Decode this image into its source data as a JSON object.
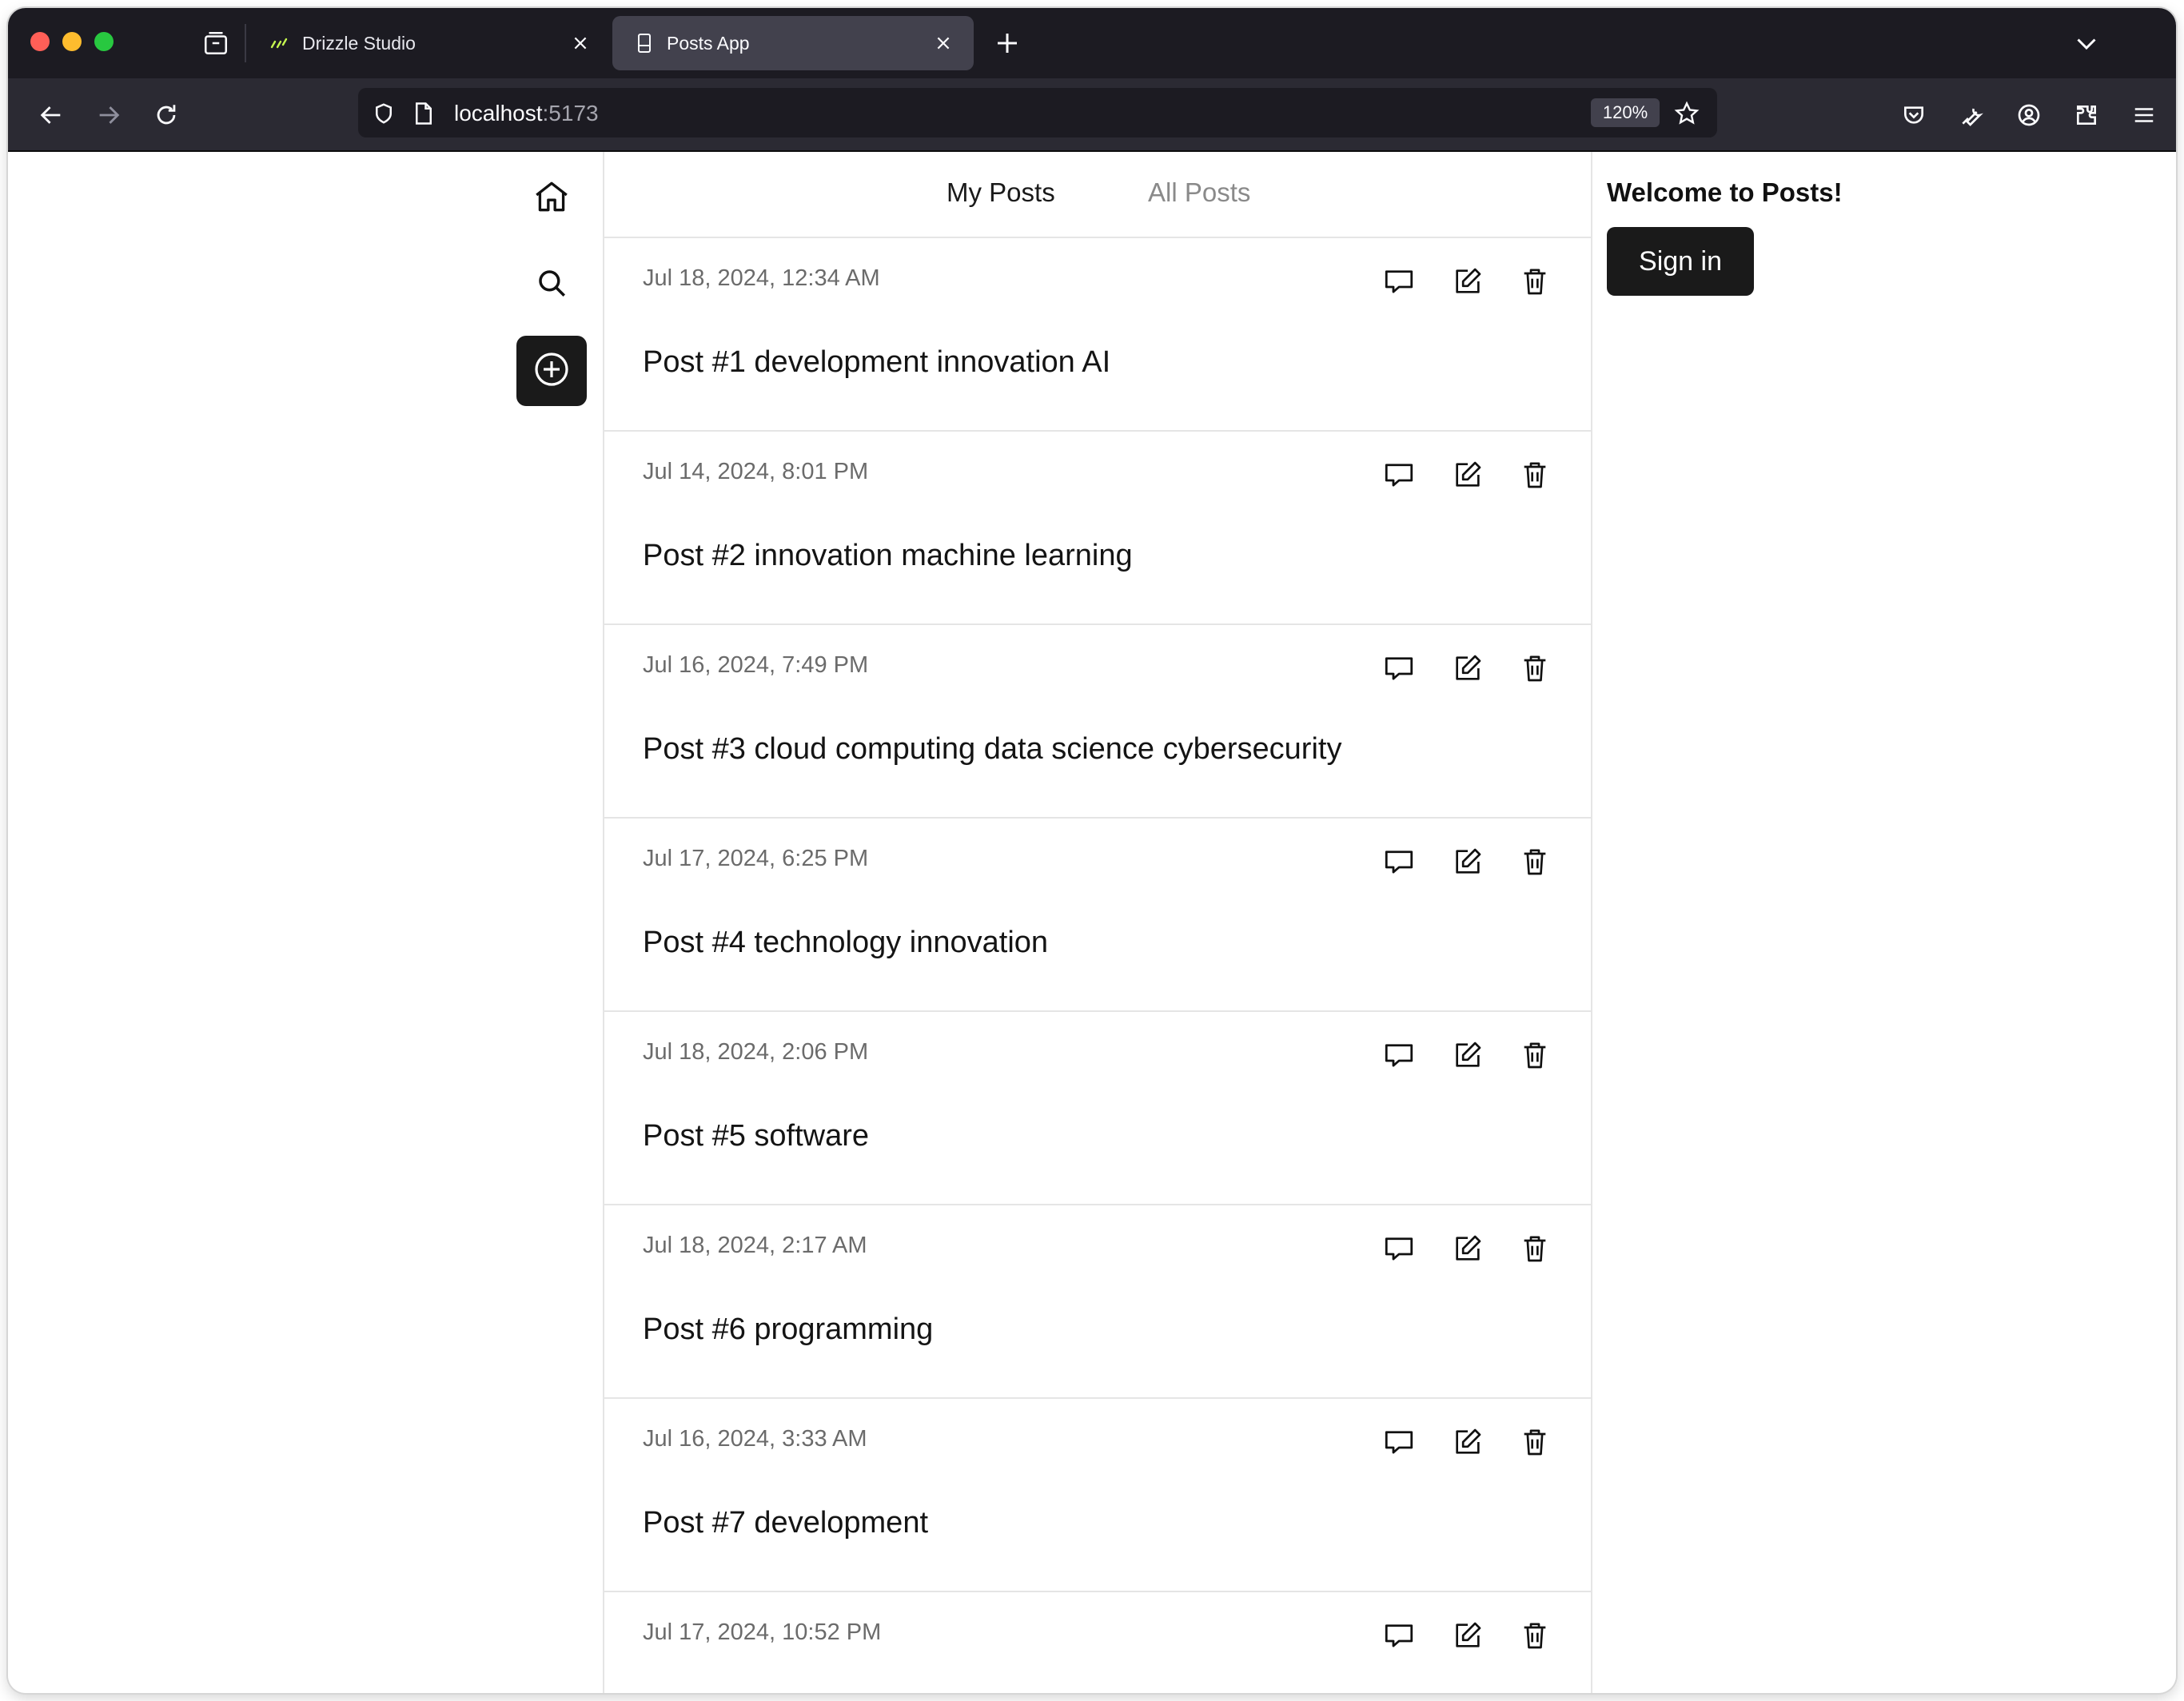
{
  "browser": {
    "tabs": [
      {
        "title": "Drizzle Studio",
        "active": false
      },
      {
        "title": "Posts App",
        "active": true
      }
    ],
    "url_host": "localhost",
    "url_port": ":5173",
    "zoom": "120%"
  },
  "feed": {
    "tabs": [
      {
        "label": "My Posts",
        "selected": true
      },
      {
        "label": "All Posts",
        "selected": false
      }
    ],
    "posts": [
      {
        "date": "Jul 18, 2024, 12:34 AM",
        "title": "Post #1 development innovation AI"
      },
      {
        "date": "Jul 14, 2024, 8:01 PM",
        "title": "Post #2 innovation machine learning"
      },
      {
        "date": "Jul 16, 2024, 7:49 PM",
        "title": "Post #3 cloud computing data science cybersecurity"
      },
      {
        "date": "Jul 17, 2024, 6:25 PM",
        "title": "Post #4 technology innovation"
      },
      {
        "date": "Jul 18, 2024, 2:06 PM",
        "title": "Post #5 software"
      },
      {
        "date": "Jul 18, 2024, 2:17 AM",
        "title": "Post #6 programming"
      },
      {
        "date": "Jul 16, 2024, 3:33 AM",
        "title": "Post #7 development"
      },
      {
        "date": "Jul 17, 2024, 10:52 PM",
        "title": ""
      }
    ]
  },
  "sidebar": {
    "icons": [
      "home-icon",
      "search-icon",
      "plus-circle-icon"
    ]
  },
  "aside": {
    "welcome": "Welcome to Posts!",
    "signin_label": "Sign in"
  },
  "colors": {
    "chrome_dark": "#1c1b22",
    "toolbar": "#2b2a33",
    "active_tab": "#42414d",
    "button_dark": "#1a1a1a",
    "muted_text": "#6b6b6b"
  }
}
